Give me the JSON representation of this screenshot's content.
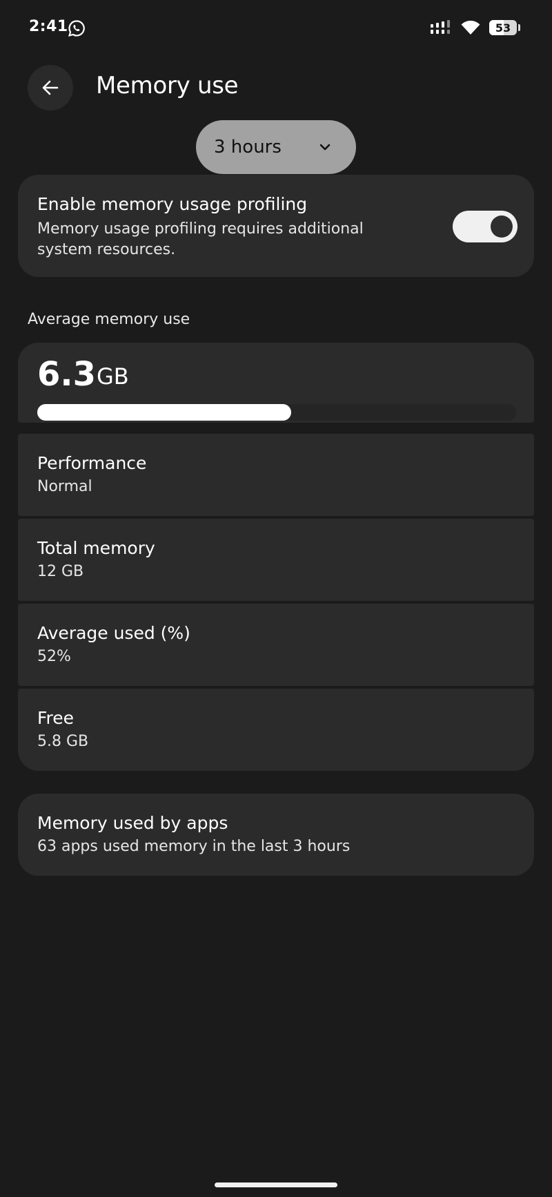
{
  "status_bar": {
    "time": "2:41",
    "battery_level": "53",
    "battery_fraction": 0.53
  },
  "header": {
    "title": "Memory use",
    "back_icon": "arrow-left-icon"
  },
  "period_selector": {
    "selected": "3 hours"
  },
  "profiling": {
    "title": "Enable memory usage profiling",
    "description": "Memory usage profiling requires additional system resources.",
    "enabled": true
  },
  "average_section": {
    "label": "Average memory use",
    "value": "6.3",
    "unit": "GB",
    "used_fraction": 0.53
  },
  "info_rows": [
    {
      "title": "Performance",
      "value": "Normal"
    },
    {
      "title": "Total memory",
      "value": "12 GB"
    },
    {
      "title": "Average used (%)",
      "value": "52%"
    },
    {
      "title": "Free",
      "value": "5.8 GB"
    }
  ],
  "apps": {
    "title": "Memory used by apps",
    "subtitle": "63 apps used memory in the last 3 hours"
  },
  "colors": {
    "background": "#1b1b1b",
    "card": "#2b2b2b",
    "dropdown": "#a2a2a2",
    "accent": "#ffffff"
  }
}
